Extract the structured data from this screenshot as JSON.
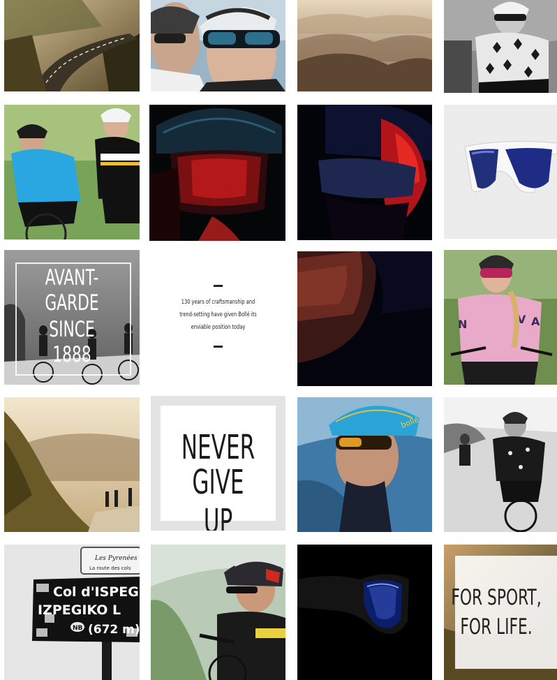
{
  "tiles": {
    "avant": {
      "lines": [
        "AVANT-",
        "GARDE",
        "SINCE",
        "1888"
      ]
    },
    "heritage": {
      "lines": [
        "130 years of craftsmanship and",
        "trend-setting have given Bollé its",
        "enviable position today"
      ]
    },
    "never": {
      "lines": [
        "NEVER",
        "GIVE UP"
      ]
    },
    "sport": {
      "lines": [
        "FOR SPORT,",
        "FOR LIFE."
      ]
    },
    "sign": {
      "top_plate": "Les Pyrenées",
      "top_sub": "La route des cols",
      "col_line": "Col d'ISPEG",
      "name_line": "IZPEGIKO L",
      "nb": "NB",
      "altitude": "(672 m)"
    },
    "helmet_brand": "bollé"
  },
  "colors": {
    "accent_red": "#e0201e",
    "accent_blue": "#2a6fd0",
    "pink": "#e9a9c8"
  }
}
